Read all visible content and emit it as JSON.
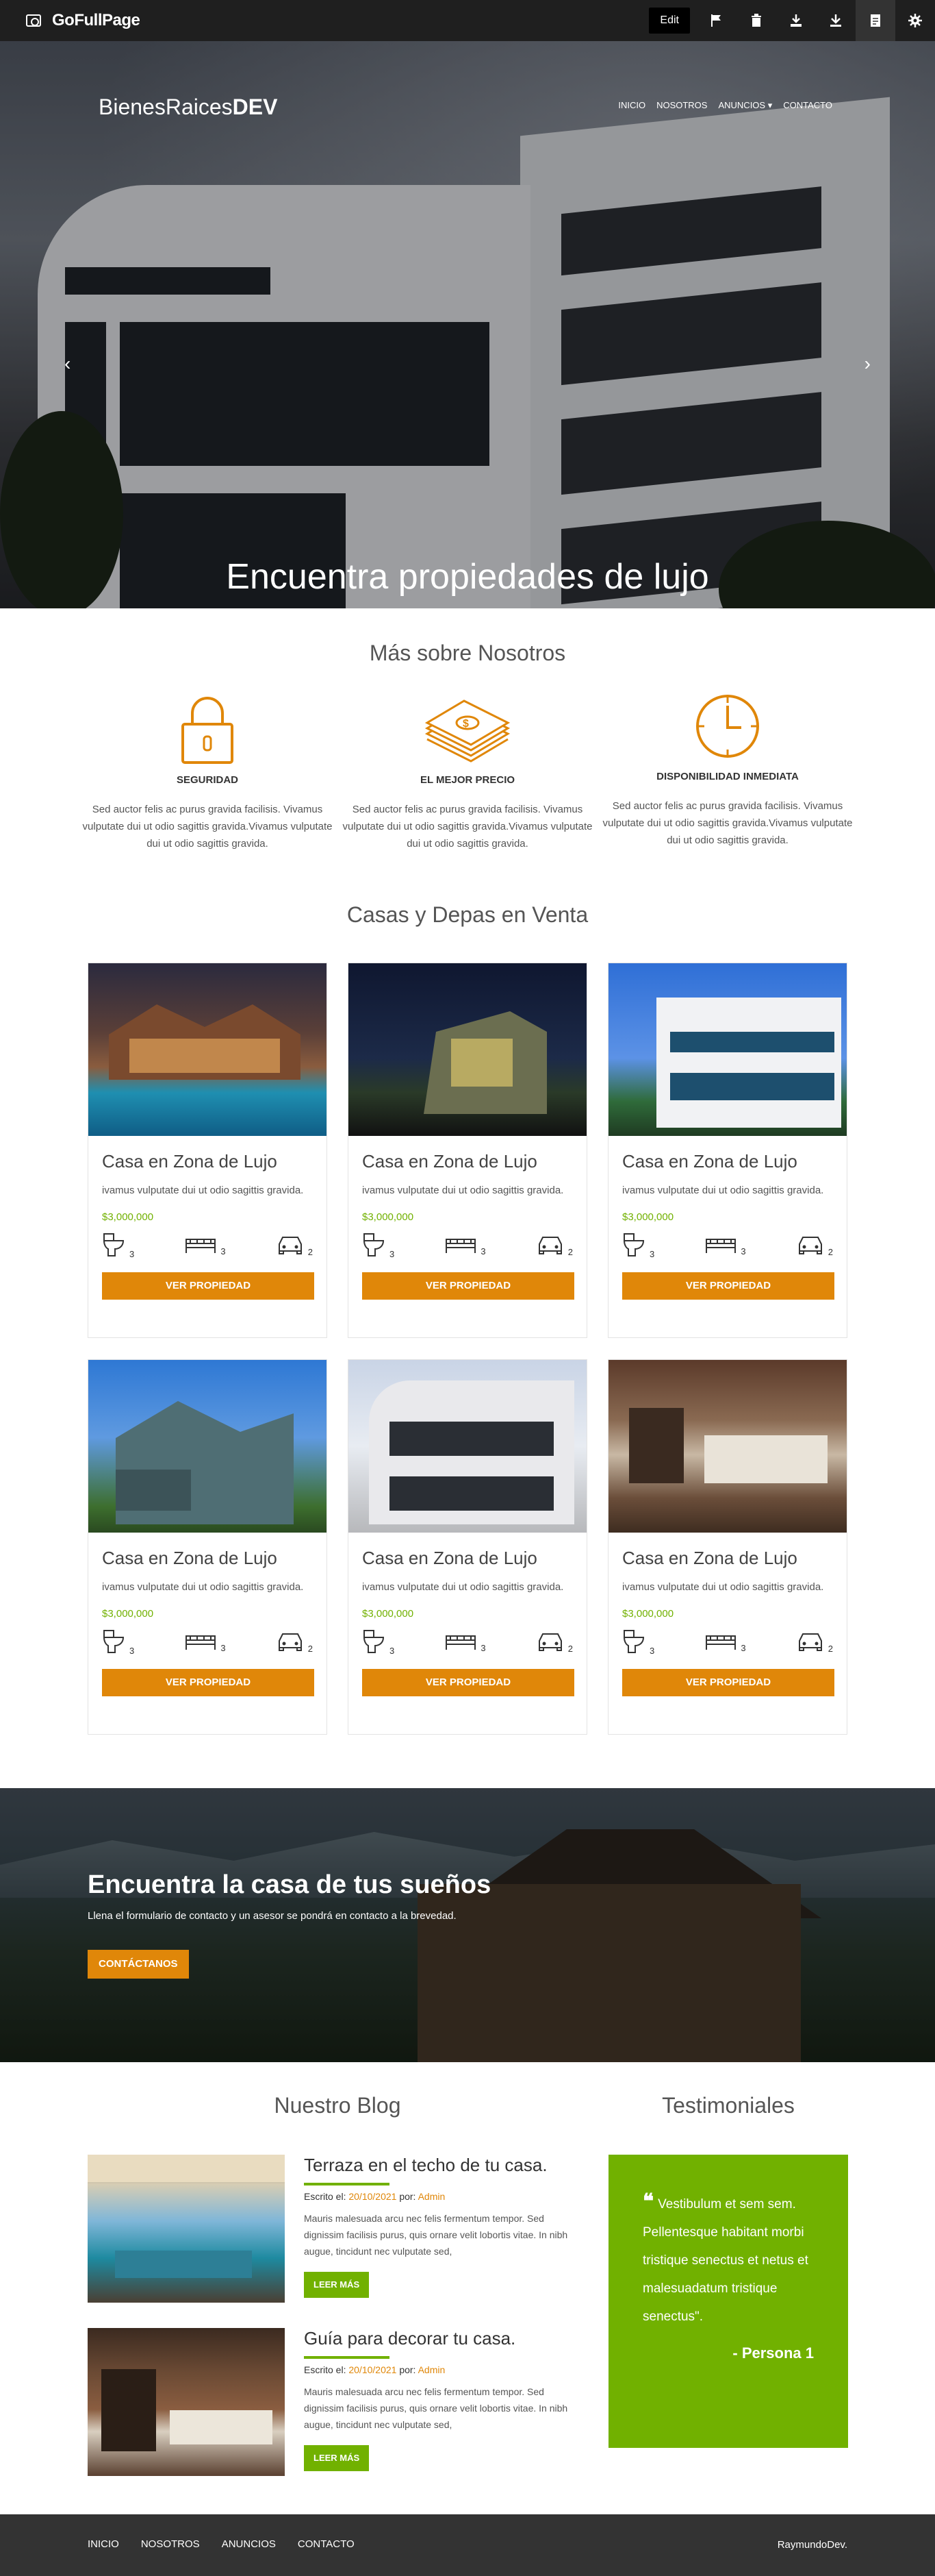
{
  "extension": {
    "name": "GoFullPage",
    "edit_label": "Edit",
    "icons": [
      "flag-icon",
      "trash-icon",
      "download-pdf-icon",
      "download-icon",
      "document-icon",
      "gear-icon"
    ]
  },
  "site": {
    "logo_light": "BienesRaices",
    "logo_bold": "DEV",
    "nav": [
      "INICIO",
      "NOSOTROS",
      "ANUNCIOS",
      "CONTACTO"
    ],
    "nav_dropdown_caret": "▾"
  },
  "hero": {
    "title": "Encuentra propiedades de lujo",
    "prev": "‹",
    "next": "›"
  },
  "about": {
    "title": "Más sobre Nosotros",
    "items": [
      {
        "icon": "lock-icon",
        "title": "SEGURIDAD",
        "text": "Sed auctor felis ac purus gravida facilisis. Vivamus vulputate dui ut odio sagittis gravida.Vivamus vulputate dui ut odio sagittis gravida."
      },
      {
        "icon": "money-icon",
        "title": "EL MEJOR PRECIO",
        "text": "Sed auctor felis ac purus gravida facilisis. Vivamus vulputate dui ut odio sagittis gravida.Vivamus vulputate dui ut odio sagittis gravida."
      },
      {
        "icon": "clock-icon",
        "title": "DISPONIBILIDAD INMEDIATA",
        "text": "Sed auctor felis ac purus gravida facilisis. Vivamus vulputate dui ut odio sagittis gravida.Vivamus vulputate dui ut odio sagittis gravida."
      }
    ]
  },
  "listings": {
    "title": "Casas y Depas en Venta",
    "cards": [
      {
        "title": "Casa en Zona de Lujo",
        "text": "ivamus vulputate dui ut odio sagittis gravida.",
        "price": "$3,000,000",
        "wc": "3",
        "beds": "3",
        "parking": "2",
        "button": "VER PROPIEDAD"
      },
      {
        "title": "Casa en Zona de Lujo",
        "text": "ivamus vulputate dui ut odio sagittis gravida.",
        "price": "$3,000,000",
        "wc": "3",
        "beds": "3",
        "parking": "2",
        "button": "VER PROPIEDAD"
      },
      {
        "title": "Casa en Zona de Lujo",
        "text": "ivamus vulputate dui ut odio sagittis gravida.",
        "price": "$3,000,000",
        "wc": "3",
        "beds": "3",
        "parking": "2",
        "button": "VER PROPIEDAD"
      },
      {
        "title": "Casa en Zona de Lujo",
        "text": "ivamus vulputate dui ut odio sagittis gravida.",
        "price": "$3,000,000",
        "wc": "3",
        "beds": "3",
        "parking": "2",
        "button": "VER PROPIEDAD"
      },
      {
        "title": "Casa en Zona de Lujo",
        "text": "ivamus vulputate dui ut odio sagittis gravida.",
        "price": "$3,000,000",
        "wc": "3",
        "beds": "3",
        "parking": "2",
        "button": "VER PROPIEDAD"
      },
      {
        "title": "Casa en Zona de Lujo",
        "text": "ivamus vulputate dui ut odio sagittis gravida.",
        "price": "$3,000,000",
        "wc": "3",
        "beds": "3",
        "parking": "2",
        "button": "VER PROPIEDAD"
      }
    ]
  },
  "contact_band": {
    "title": "Encuentra la casa de tus sueños",
    "text": "Llena el formulario de contacto y un asesor se pondrá en contacto a la brevedad.",
    "button": "CONTÁCTANOS"
  },
  "blog": {
    "title": "Nuestro Blog",
    "posts": [
      {
        "title": "Terraza en el techo de tu casa.",
        "written": "Escrito el: ",
        "date": "20/10/2021",
        "by": " por: ",
        "author": "Admin",
        "text": "Mauris malesuada arcu nec felis fermentum tempor. Sed dignissim facilisis purus, quis ornare velit lobortis vitae. In nibh augue, tincidunt nec vulputate sed,",
        "button": "LEER MÁS"
      },
      {
        "title": "Guía para decorar tu casa.",
        "written": "Escrito el: ",
        "date": "20/10/2021",
        "by": " por: ",
        "author": "Admin",
        "text": "Mauris malesuada arcu nec felis fermentum tempor. Sed dignissim facilisis purus, quis ornare velit lobortis vitae. In nibh augue, tincidunt nec vulputate sed,",
        "button": "LEER MÁS"
      }
    ]
  },
  "testimonials": {
    "title": "Testimoniales",
    "quote_mark": "❝",
    "quote": "Vestibulum et sem sem. Pellentesque habitant morbi tristique senectus et netus et malesuadatum tristique senectus\".",
    "author": "- Persona 1"
  },
  "footer": {
    "nav": [
      "INICIO",
      "NOSOTROS",
      "ANUNCIOS",
      "CONTACTO"
    ],
    "copyright": "RaymundoDev."
  },
  "colors": {
    "accent": "#e08709",
    "green": "#71b100",
    "footer": "#333333"
  }
}
